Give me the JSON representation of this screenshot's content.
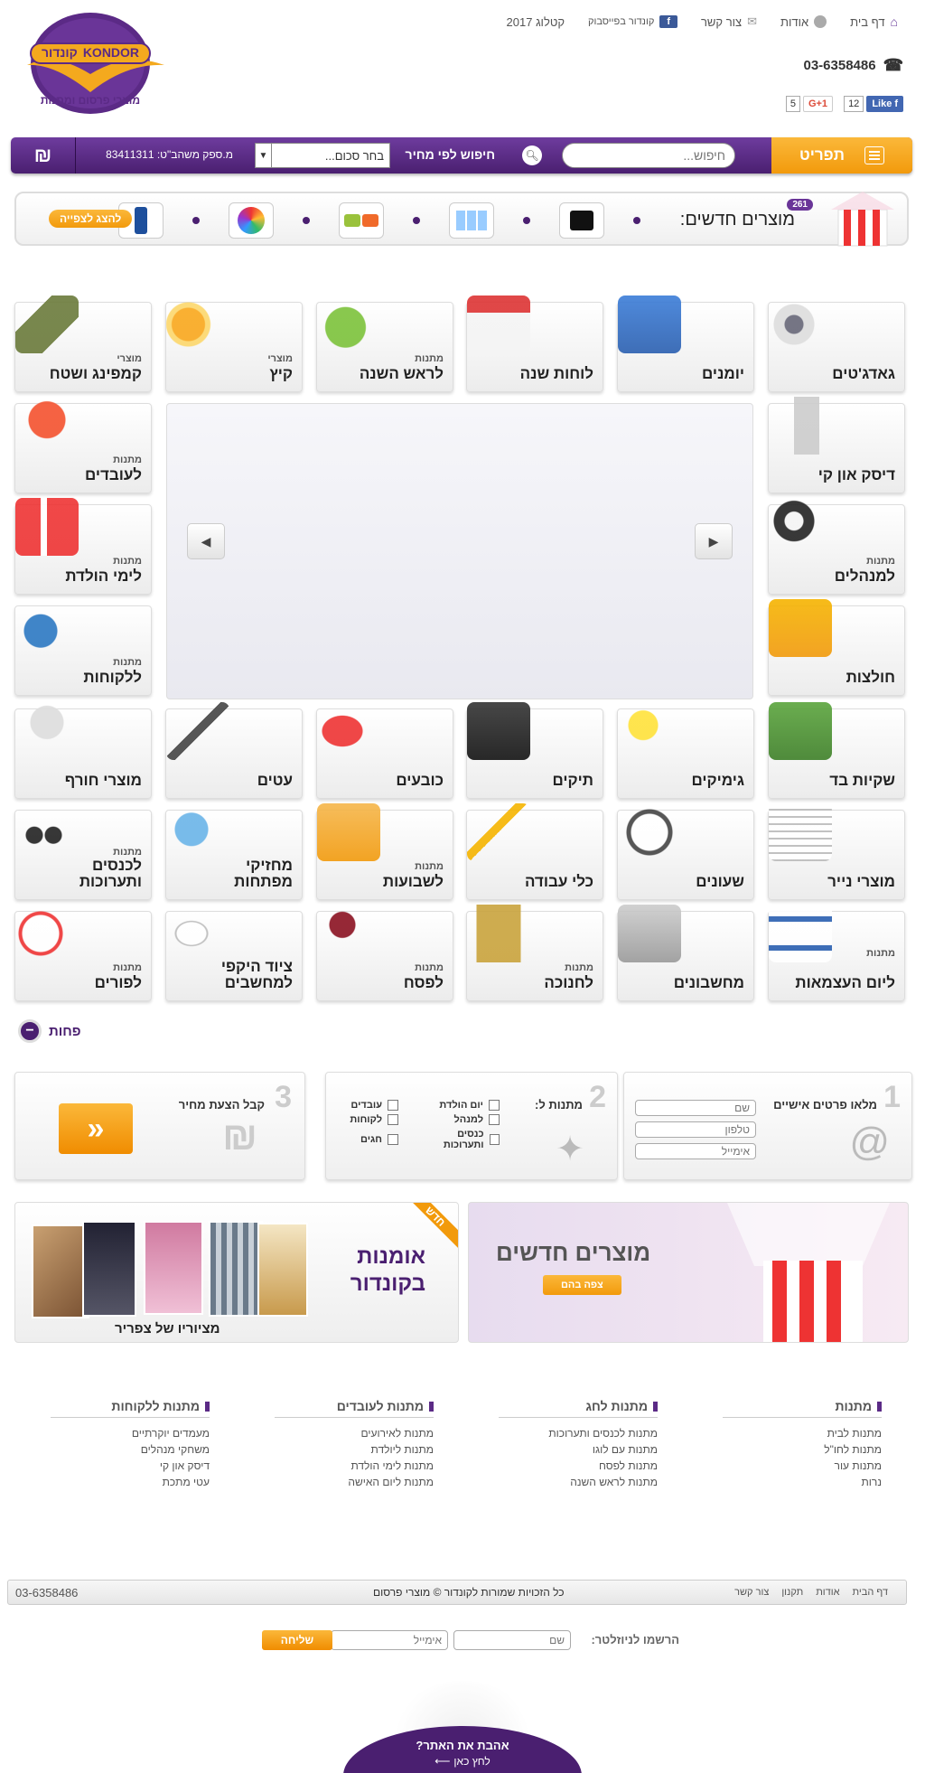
{
  "topnav": {
    "home": "דף בית",
    "about": "אודות",
    "contact": "צור קשר",
    "facebook": "קונדור בפייסבוק",
    "catalog": "קטלוג 2017"
  },
  "logo": {
    "brand_en": "KONDOR",
    "brand_he": "קונדור",
    "tagline": "מוצרי פרסום ומתנות"
  },
  "phone": "03-6358486",
  "social": {
    "like_label": "Like",
    "like_count": "12",
    "gplus_label": "G+1",
    "gplus_count": "5"
  },
  "toolbar": {
    "menu_label": "תפריט",
    "search_placeholder": "חיפוש...",
    "price_search_label": "חיפוש לפי מחיר",
    "amount_select": "בחר סכום...",
    "supplier_label": "מ.ספק משהב\"ט: 83411311",
    "shekel_symbol": "₪"
  },
  "new_products": {
    "label": "מוצרים חדשים:",
    "badge": "261",
    "view_button": "להצג לצפייה"
  },
  "categories_row1": [
    {
      "sub": "",
      "label": "גאדג'טים",
      "icon": "camera-icon"
    },
    {
      "sub": "",
      "label": "יומנים",
      "icon": "notebook-icon"
    },
    {
      "sub": "",
      "label": "לוחות שנה",
      "icon": "calendar-icon"
    },
    {
      "sub": "מתנות",
      "label": "לראש השנה",
      "icon": "apple-icon"
    },
    {
      "sub": "מוצרי",
      "label": "קיץ",
      "icon": "sun-icon"
    },
    {
      "sub": "מוצרי",
      "label": "קמפינג ושטח",
      "icon": "tent-icon"
    }
  ],
  "categories_side_right": [
    {
      "sub": "",
      "label": "דיסק און קי",
      "icon": "usb-icon"
    },
    {
      "sub": "מתנות",
      "label": "למנהלים",
      "icon": "manager-icon"
    },
    {
      "sub": "",
      "label": "חולצות",
      "icon": "shirt-icon"
    }
  ],
  "categories_side_left": [
    {
      "sub": "מתנות",
      "label": "לעובדים",
      "icon": "balloon-icon"
    },
    {
      "sub": "מתנות",
      "label": "לימי הולדת",
      "icon": "gift-icon"
    },
    {
      "sub": "מתנות",
      "label": "ללקוחות",
      "icon": "bear-icon"
    }
  ],
  "categories_row5": [
    {
      "sub": "",
      "label": "שקיות בד",
      "icon": "bag-icon"
    },
    {
      "sub": "",
      "label": "גימיקים",
      "icon": "bulb-icon"
    },
    {
      "sub": "",
      "label": "תיקים",
      "icon": "briefcase-icon"
    },
    {
      "sub": "",
      "label": "כובעים",
      "icon": "cap-icon"
    },
    {
      "sub": "",
      "label": "עטים",
      "icon": "pen-icon"
    },
    {
      "sub": "",
      "label": "מוצרי חורף",
      "icon": "cloud-rain-icon"
    }
  ],
  "categories_row6": [
    {
      "sub": "",
      "label": "מוצרי נייר",
      "icon": "paper-icon"
    },
    {
      "sub": "",
      "label": "שעונים",
      "icon": "clock-icon"
    },
    {
      "sub": "",
      "label": "כלי עבודה",
      "icon": "hammer-icon"
    },
    {
      "sub": "מתנות",
      "label": "לשבועות",
      "icon": "cheese-icon"
    },
    {
      "sub": "",
      "label": "מחזיקי מפתחות",
      "icon": "keychain-icon"
    },
    {
      "sub": "מתנות",
      "label": "לכנסים ותערוכות",
      "icon": "conference-icon"
    }
  ],
  "categories_row7": [
    {
      "sub": "מתנות",
      "label": "ליום העצמאות",
      "icon": "flag-icon"
    },
    {
      "sub": "",
      "label": "מחשבונים",
      "icon": "calculator-icon"
    },
    {
      "sub": "מתנות",
      "label": "לחנוכה",
      "icon": "menorah-icon"
    },
    {
      "sub": "מתנות",
      "label": "לפסח",
      "icon": "wine-icon"
    },
    {
      "sub": "",
      "label": "ציוד היקפי למחשבים",
      "icon": "mouse-icon"
    },
    {
      "sub": "מתנות",
      "label": "לפורים",
      "icon": "clown-icon"
    }
  ],
  "less_label": "פחות",
  "steps": {
    "step1": {
      "num": "1",
      "title": "מלאו פרטים אישיים",
      "name_ph": "שם",
      "phone_ph": "טלפון",
      "email_ph": "אימייל"
    },
    "step2": {
      "num": "2",
      "title": "מתנות ל:",
      "opts": [
        "יום הולדת",
        "עובדים",
        "למנהל",
        "לקוחות",
        "כנסים ותערוכות",
        "חגים"
      ]
    },
    "step3": {
      "num": "3",
      "title": "קבל הצעת מחיר",
      "button": "«"
    }
  },
  "banners": {
    "new_title": "מוצרים חדשים",
    "new_button": "צפה בהם",
    "art_title_1": "אומנות",
    "art_title_2": "בקונדור",
    "art_caption": "מציוריו של צפריר",
    "art_ribbon": "חדש"
  },
  "footer_cols": [
    {
      "title": "מתנות",
      "items": [
        "מתנות לבית",
        "מתנות לחו\"ל",
        "מתנות עור",
        "נרות"
      ]
    },
    {
      "title": "מתנות לחג",
      "items": [
        "מתנות לכנסים ותערוכות",
        "מתנות עם לוגו",
        "מתנות לפסח",
        "מתנות לראש השנה"
      ]
    },
    {
      "title": "מתנות לעובדים",
      "items": [
        "מתנות לאירועים",
        "מתנות ליולדת",
        "מתנות לימי הולדת",
        "מתנות ליום האישה"
      ]
    },
    {
      "title": "מתנות ללקוחות",
      "items": [
        "מעמדים יוקרתיים",
        "משחקי מנהלים",
        "דיסק און קי",
        "עטי מתכת"
      ]
    }
  ],
  "bottom_bar": {
    "links": [
      "דף הבית",
      "אודות",
      "תקנון",
      "צור קשר"
    ],
    "copyright": "כל הזכויות שמורות לקונדור © מוצרי פרסום",
    "phone": "03-6358486"
  },
  "newsletter": {
    "label": "הרשמו לניוזלטר:",
    "name_ph": "שם",
    "email_ph": "אימייל",
    "button": "שליחה"
  },
  "love": {
    "line1": "אהבת את האתר?",
    "line2": "לחץ כאן"
  }
}
